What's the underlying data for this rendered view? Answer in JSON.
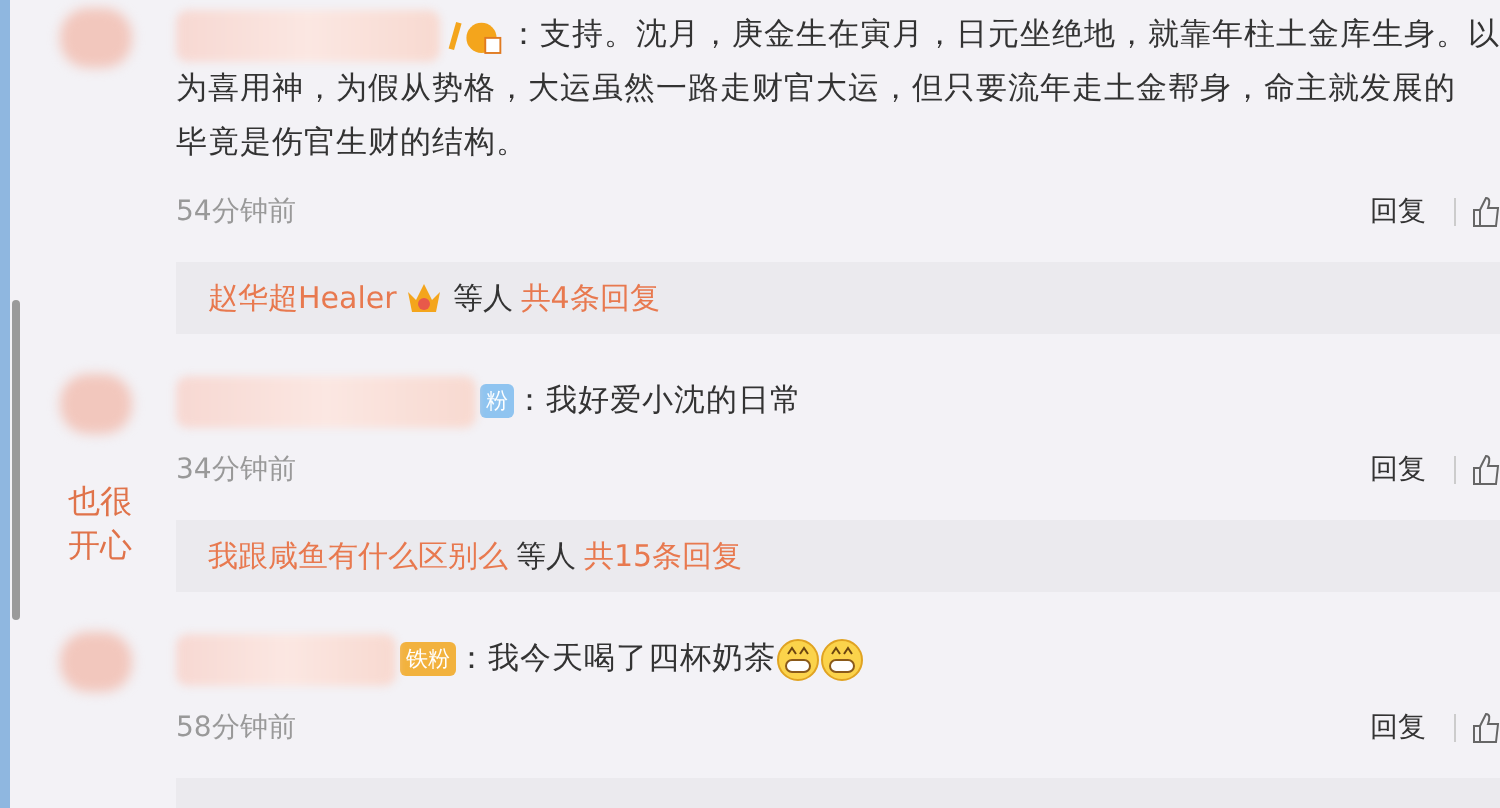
{
  "side_note": {
    "lines": [
      "也很",
      "开心"
    ]
  },
  "comments": [
    {
      "lines": [
        "：支持。沈月，庚金生在寅月，日元坐绝地，就靠年柱土金库生身。以",
        "为喜用神，为假从势格，大运虽然一路走财官大运，但只要流年走土金帮身，命主就发展的",
        "毕竟是伤官生财的结构。"
      ],
      "time": "54分钟前",
      "reply": "回复",
      "thread": {
        "lead": "赵华超Healer",
        "crowned": true,
        "others": "等人",
        "count": "共4条回复"
      }
    },
    {
      "badge": {
        "text": "粉",
        "color": "#8fc4f0"
      },
      "lines": [
        "：我好爱小沈的日常"
      ],
      "time": "34分钟前",
      "reply": "回复",
      "thread": {
        "lead": "我跟咸鱼有什么区别么",
        "crowned": false,
        "others": "等人",
        "count": "共15条回复"
      }
    },
    {
      "badge": {
        "text": "铁粉",
        "color": "#f2b23e"
      },
      "lines": [
        "：我今天喝了四杯奶茶"
      ],
      "emojis": [
        {
          "kind": "grin"
        },
        {
          "kind": "grin"
        }
      ],
      "time": "58分钟前",
      "reply": "回复"
    }
  ]
}
